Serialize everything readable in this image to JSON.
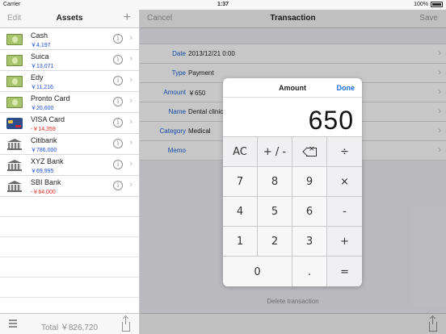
{
  "status": {
    "carrier": "Carrier",
    "time": "1:37",
    "battery": "100%"
  },
  "left": {
    "edit_label": "Edit",
    "title": "Assets",
    "add_label": "+",
    "assets": [
      {
        "name": "Cash",
        "amount": "￥4,197",
        "icon": "cash-icon",
        "negative": false
      },
      {
        "name": "Suica",
        "amount": "￥13,071",
        "icon": "cash-icon",
        "negative": false
      },
      {
        "name": "Edy",
        "amount": "￥11,216",
        "icon": "cash-icon",
        "negative": false
      },
      {
        "name": "Pronto Card",
        "amount": "￥20,600",
        "icon": "cash-icon",
        "negative": false
      },
      {
        "name": "VISA Card",
        "amount": "-￥14,359",
        "icon": "credit-card-icon",
        "negative": true
      },
      {
        "name": "Citibank",
        "amount": "￥786,000",
        "icon": "bank-icon",
        "negative": false
      },
      {
        "name": "XYZ Bank",
        "amount": "￥69,995",
        "icon": "bank-icon",
        "negative": false
      },
      {
        "name": "SBI Bank",
        "amount": "-￥64,000",
        "icon": "bank-icon",
        "negative": true
      }
    ],
    "info_label": "i",
    "total": "Total ￥826,720"
  },
  "right": {
    "cancel_label": "Cancel",
    "title": "Transaction",
    "save_label": "Save",
    "fields": [
      {
        "label": "Date",
        "value": "2013/12/21 0:00"
      },
      {
        "label": "Type",
        "value": "Payment"
      },
      {
        "label": "Amount",
        "value": "￥650"
      },
      {
        "label": "Name",
        "value": "Dental clinic"
      },
      {
        "label": "Category",
        "value": "Medical"
      },
      {
        "label": "Memo",
        "value": ""
      }
    ],
    "delete_label": "Delete transaction"
  },
  "popover": {
    "title": "Amount",
    "done_label": "Done",
    "display": "650",
    "keys": {
      "ac": "AC",
      "sign": "+ / -",
      "divide": "÷",
      "k7": "7",
      "k8": "8",
      "k9": "9",
      "multiply": "×",
      "k4": "4",
      "k5": "5",
      "k6": "6",
      "minus": "-",
      "k1": "1",
      "k2": "2",
      "k3": "3",
      "plus": "+",
      "k0": "0",
      "dot": ".",
      "equals": "="
    }
  },
  "colors": {
    "accent": "#1a6fe0",
    "label_blue": "#1a5fd6",
    "negative": "#e0261b"
  }
}
